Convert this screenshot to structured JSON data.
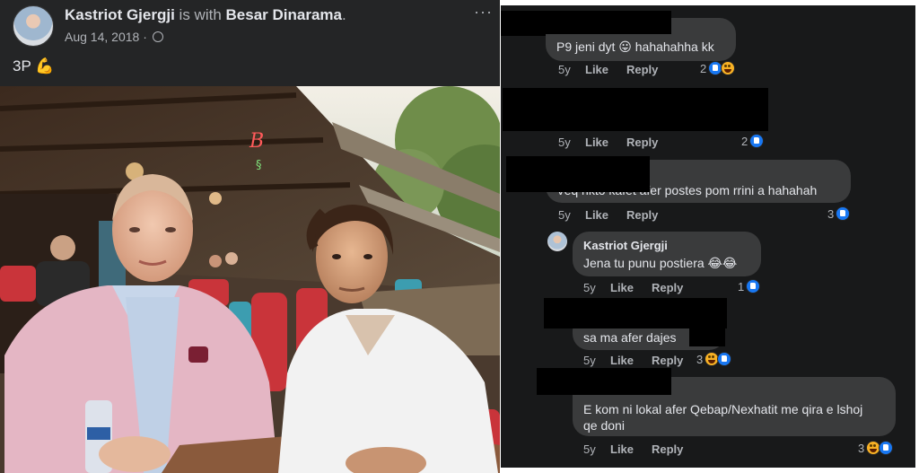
{
  "post": {
    "author": "Kastriot Gjergji",
    "with_text": "is with",
    "tagged": "Besar Dinarama",
    "period": ".",
    "date": "Aug 14, 2018",
    "dot": "·",
    "more": "···",
    "text": "3P",
    "text_emoji": "💪"
  },
  "comments": [
    {
      "id": "c1",
      "text": "P9 jeni dyt 😛 hahahahha kk",
      "time": "5y",
      "like": "Like",
      "reply": "Reply",
      "reaction_count": "2",
      "reactions": [
        "like",
        "haha"
      ]
    },
    {
      "id": "c2",
      "text": "",
      "time": "5y",
      "like": "Like",
      "reply": "Reply",
      "reaction_count": "2",
      "reactions": [
        "like"
      ]
    },
    {
      "id": "c3",
      "text": "Veq nkto kafet afer postes pom rrini a hahahah",
      "time": "5y",
      "like": "Like",
      "reply": "Reply",
      "reaction_count": "3",
      "reactions": [
        "like"
      ]
    },
    {
      "id": "c4",
      "author": "Kastriot Gjergji",
      "text": "Jena tu punu postiera 😂😂",
      "time": "5y",
      "like": "Like",
      "reply": "Reply",
      "reaction_count": "1",
      "reactions": [
        "like"
      ]
    },
    {
      "id": "c5",
      "text": "sa ma afer dajes",
      "time": "5y",
      "like": "Like",
      "reply": "Reply",
      "reaction_count": "3",
      "reactions": [
        "haha",
        "like"
      ]
    },
    {
      "id": "c6",
      "text_line1": "E kom ni lokal afer Qebap/Nexhatit me qira e lshoj",
      "text_line2": "qe doni",
      "time": "5y",
      "like": "Like",
      "reply": "Reply",
      "reaction_count": "3",
      "reactions": [
        "haha",
        "like"
      ]
    }
  ],
  "colors": {
    "post_bg": "#242526",
    "comments_bg": "#18191a",
    "bubble": "#3a3b3c",
    "text": "#e4e6eb",
    "muted": "#b0b3b8",
    "like_blue": "#1877f2",
    "haha_yellow": "#f7b125",
    "redaction": "#000000"
  },
  "icons": [
    "avatar",
    "globe-icon",
    "more-icon",
    "like-reaction-icon",
    "haha-reaction-icon"
  ]
}
